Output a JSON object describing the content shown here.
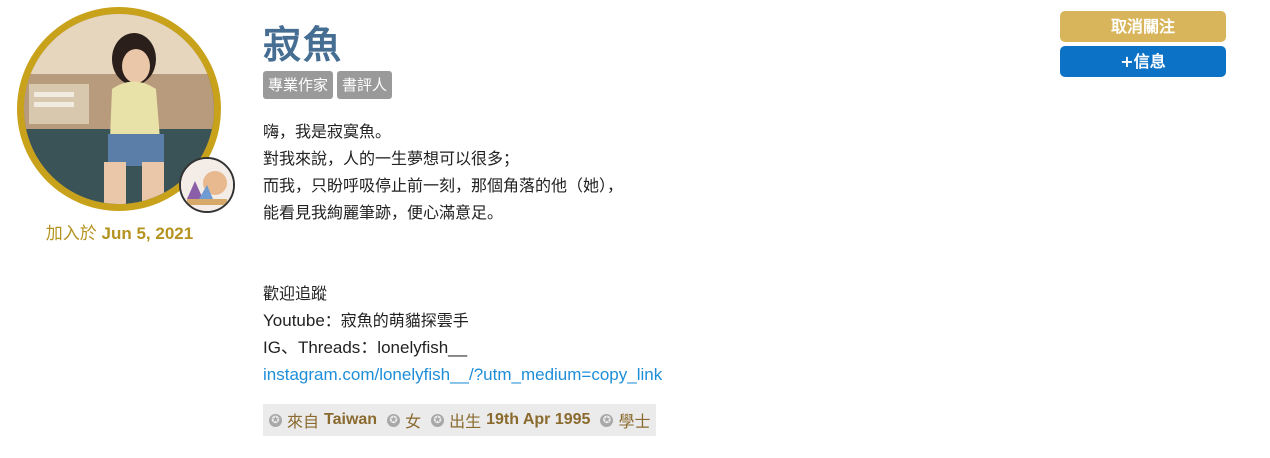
{
  "profile": {
    "name": "寂魚",
    "joined_label": "加入於",
    "joined_date": "Jun 5, 2021",
    "tags": [
      "專業作家",
      "書評人"
    ]
  },
  "bio": {
    "line1": "嗨，我是寂寞魚。",
    "line2": "對我來說，人的一生夢想可以很多；",
    "line3": "而我，只盼呼吸停止前一刻，那個角落的他（她），",
    "line4": "能看見我絢麗筆跡，便心滿意足。",
    "follow_heading": "歡迎追蹤",
    "youtube_label": "Youtube",
    "youtube_value": "：寂魚的萌貓探雲手",
    "ig_label": "IG、Threads",
    "ig_value": "：lonelyfish__",
    "link": "instagram.com/lonelyfish__/?utm_medium=copy_link"
  },
  "facts": {
    "from_label": "來自",
    "from_value": "Taiwan",
    "gender": "女",
    "born_label": "出生",
    "born_value": "19th Apr 1995",
    "education": "學士"
  },
  "actions": {
    "unfollow": "取消關注",
    "message": "+信息"
  },
  "colors": {
    "name": "#466e93",
    "gold": "#c9a21b",
    "unfollow_bg": "#d8b55b",
    "message_bg": "#0c72c6",
    "link": "#1e8ed8"
  }
}
